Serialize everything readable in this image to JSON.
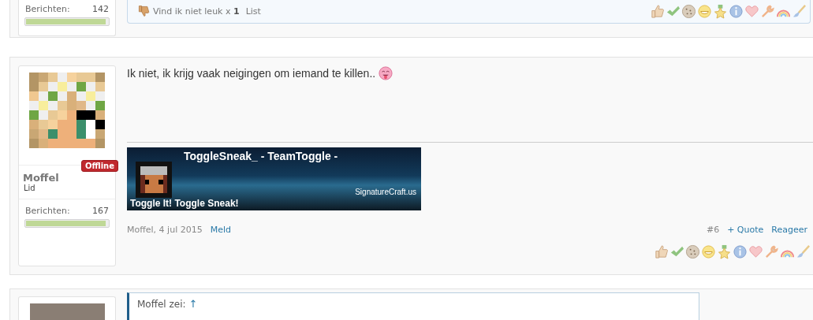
{
  "previous_post": {
    "user_stats": {
      "label": "Berichten:",
      "value": "142",
      "level": 0.97
    },
    "likes_bar": {
      "text": "Vind ik niet leuk x ",
      "count": "1",
      "link": "List"
    }
  },
  "post": {
    "message": "Ik niet, ik krijg vaak neigingen om iemand te killen..",
    "user": {
      "name": "Moffel",
      "role": "Lid",
      "status": "Offline",
      "stats_label": "Berichten:",
      "stats_value": "167",
      "level": 0.97
    },
    "signature": {
      "title": "ToggleSneak_ - TeamToggle -",
      "tagline": "Toggle It! Toggle Sneak!",
      "site": "SignatureCraft.us"
    },
    "meta": {
      "author_date": "Moffel, 4 jul 2015",
      "report": "Meld",
      "number": "#6",
      "quote": "+ Quote",
      "reply": "Reageer"
    }
  },
  "next_post": {
    "quote_header": "Moffel zei:",
    "quote_arrow": "↑"
  }
}
